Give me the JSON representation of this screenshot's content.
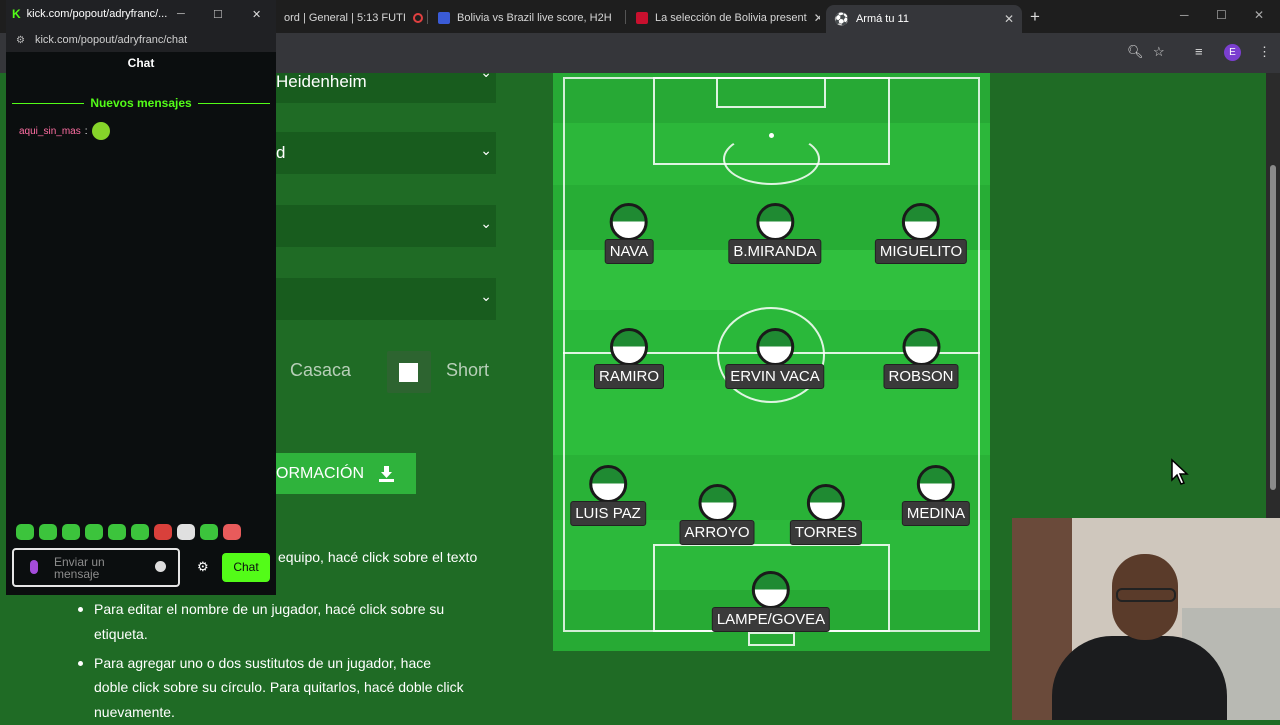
{
  "browser": {
    "tabs": [
      {
        "label": "ord | General | 5:13 FUTI"
      },
      {
        "label": "Bolivia vs Brazil live score, H2H"
      },
      {
        "label": "La selección de Bolivia present"
      },
      {
        "label": "Armá tu 11"
      }
    ],
    "colors": {
      "tabbar": "#1e1e1e",
      "toolbar": "#35363a",
      "profile": "#7b3fd0"
    },
    "profile_letter": "E"
  },
  "chat_window": {
    "title": "kick.com/popout/adryfranc/...",
    "url": "kick.com/popout/adryfranc/chat",
    "heading": "Chat",
    "new_messages": "Nuevos mensajes",
    "message": {
      "user": "aqui_sin_mas",
      "colon": ":"
    },
    "input_placeholder": "Enviar un mensaje",
    "send_label": "Chat",
    "accent": "#53fc18"
  },
  "form": {
    "team_select": "Heidenheim",
    "select2": "d",
    "casaca_label": "Casaca",
    "short_label": "Short",
    "download_label": "ORMACIÓN"
  },
  "instructions": {
    "line1": "equipo, hacé click sobre el texto",
    "item2a": "Para editar el nombre de un jugador, hacé click sobre su",
    "item2b": "etiqueta.",
    "item3a": "Para agregar uno o dos sustitutos de un jugador, hace",
    "item3b": "doble click sobre su círculo. Para quitarlos, hacé doble click",
    "item3c": "nuevamente."
  },
  "players": [
    {
      "name": "NAVA"
    },
    {
      "name": "B.MIRANDA"
    },
    {
      "name": "MIGUELITO"
    },
    {
      "name": "RAMIRO"
    },
    {
      "name": "ERVIN VACA"
    },
    {
      "name": "ROBSON"
    },
    {
      "name": "LUIS PAZ"
    },
    {
      "name": "ARROYO"
    },
    {
      "name": "TORRES"
    },
    {
      "name": "MEDINA"
    },
    {
      "name": "LAMPE/GOVEA"
    }
  ]
}
